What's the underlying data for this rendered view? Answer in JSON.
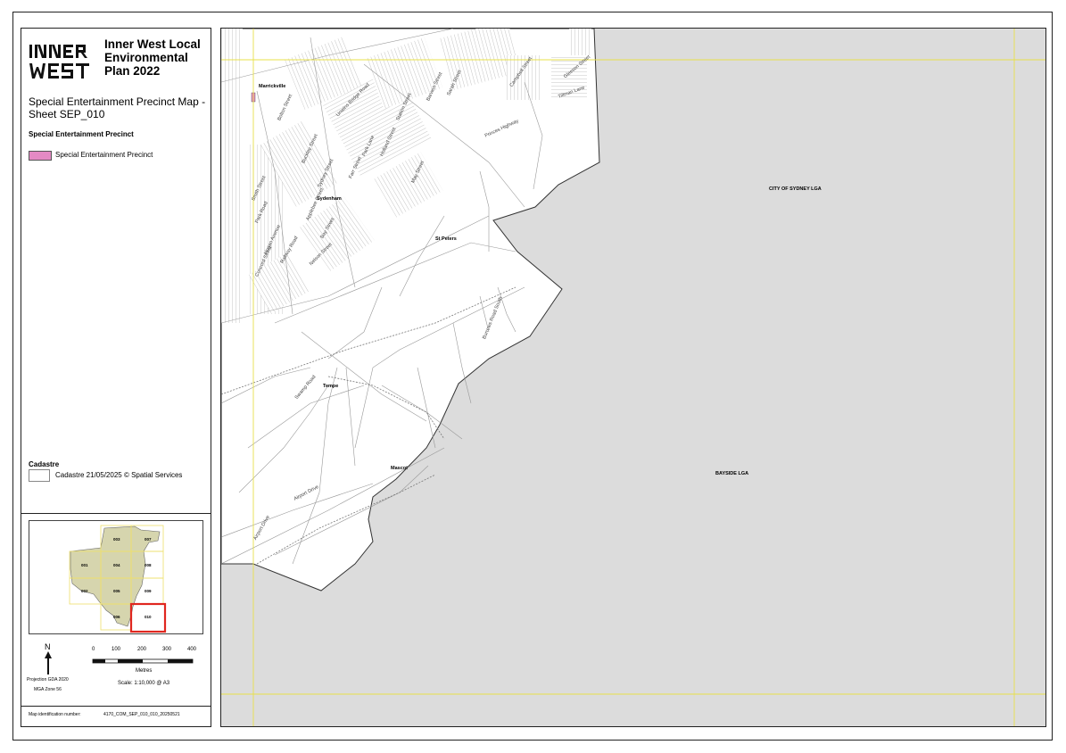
{
  "header": {
    "logo_text": "INNER WEST",
    "plan_title": "Inner West Local Environmental Plan 2022",
    "map_title": "Special Entertainment Precinct Map - Sheet SEP_010"
  },
  "legend": {
    "heading": "Special Entertainment Precinct",
    "items": [
      {
        "label": "Special Entertainment Precinct",
        "color": "#e48ac4"
      }
    ],
    "cadastre_heading": "Cadastre",
    "cadastre_label": "Cadastre 21/05/2025 © Spatial Services"
  },
  "index_map": {
    "sheets": [
      "003",
      "007",
      "001",
      "004",
      "008",
      "002",
      "005",
      "009",
      "006",
      "010"
    ],
    "current_sheet": "010",
    "highlight_color": "#e0271f"
  },
  "north_arrow": {
    "label": "N"
  },
  "projection": {
    "line1": "Projection GDA 2020",
    "line2": "MGA Zone 56"
  },
  "scale": {
    "ticks": [
      "0",
      "100",
      "200",
      "300",
      "400"
    ],
    "units": "Metres",
    "text": "Scale: 1:10,000 @ A3"
  },
  "footer": {
    "map_id_label": "Map identification number:",
    "map_id_value": "4170_COM_SEP_010_010_20250521"
  },
  "map": {
    "suburbs": [
      "Marrickville",
      "Sydenham",
      "St Peters",
      "Tempe",
      "Mascot"
    ],
    "lgas": [
      "CITY OF SYDNEY LGA",
      "BAYSIDE LGA"
    ],
    "streets": [
      "Bolton Street",
      "Unwins Bridge Road",
      "Princes Highway",
      "Railway Road",
      "Swamp Road",
      "Burrows Road South",
      "Airport Drive",
      "Smith Street",
      "Park Road",
      "Hogan Avenue",
      "Concord Street",
      "Applebee Street",
      "Buckley Street",
      "Sydney Street",
      "Farr Street",
      "Park Lane",
      "Holland Street",
      "Station Street",
      "Barwon Street",
      "Sarah Street",
      "May Street",
      "Campbell Street",
      "Gleeson Street",
      "Tillman Lane",
      "Nelson Street",
      "Bay Street"
    ],
    "colors": {
      "outside": "#dcdcdc",
      "land": "#ffffff",
      "grid": "#e8e04a",
      "precinct": "#e48ac4"
    }
  }
}
